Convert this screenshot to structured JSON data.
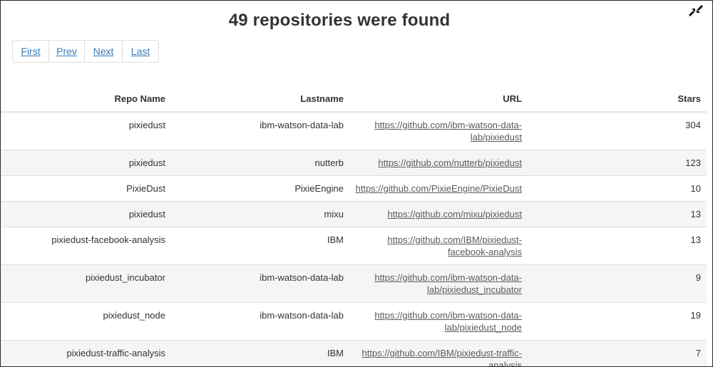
{
  "heading": "49 repositories were found",
  "pagination": {
    "first": "First",
    "prev": "Prev",
    "next": "Next",
    "last": "Last"
  },
  "table": {
    "headers": [
      "Repo Name",
      "Lastname",
      "URL",
      "Stars"
    ],
    "rows": [
      {
        "name": "pixiedust",
        "lastname": "ibm-watson-data-lab",
        "url_line1": "https://github.com/ibm-watson-data-",
        "url_line2": "lab/pixiedust",
        "stars": "304"
      },
      {
        "name": "pixiedust",
        "lastname": "nutterb",
        "url_line1": "https://github.com/nutterb/pixiedust",
        "url_line2": "",
        "stars": "123"
      },
      {
        "name": "PixieDust",
        "lastname": "PixieEngine",
        "url_line1": "https://github.com/PixieEngine/PixieDust",
        "url_line2": "",
        "stars": "10"
      },
      {
        "name": "pixiedust",
        "lastname": "mixu",
        "url_line1": "https://github.com/mixu/pixiedust",
        "url_line2": "",
        "stars": "13"
      },
      {
        "name": "pixiedust-facebook-analysis",
        "lastname": "IBM",
        "url_line1": "https://github.com/IBM/pixiedust-",
        "url_line2": "facebook-analysis",
        "stars": "13"
      },
      {
        "name": "pixiedust_incubator",
        "lastname": "ibm-watson-data-lab",
        "url_line1": "https://github.com/ibm-watson-data-",
        "url_line2": "lab/pixiedust_incubator",
        "stars": "9"
      },
      {
        "name": "pixiedust_node",
        "lastname": "ibm-watson-data-lab",
        "url_line1": "https://github.com/ibm-watson-data-",
        "url_line2": "lab/pixiedust_node",
        "stars": "19"
      },
      {
        "name": "pixiedust-traffic-analysis",
        "lastname": "IBM",
        "url_line1": "https://github.com/IBM/pixiedust-traffic-",
        "url_line2": "analysis",
        "stars": "7"
      }
    ]
  },
  "icons": {
    "corner": "collapse-arrows-icon"
  },
  "colors": {
    "link": "#337ab7",
    "stripe": "#f5f5f5",
    "border": "#dddddd",
    "text": "#333333"
  }
}
